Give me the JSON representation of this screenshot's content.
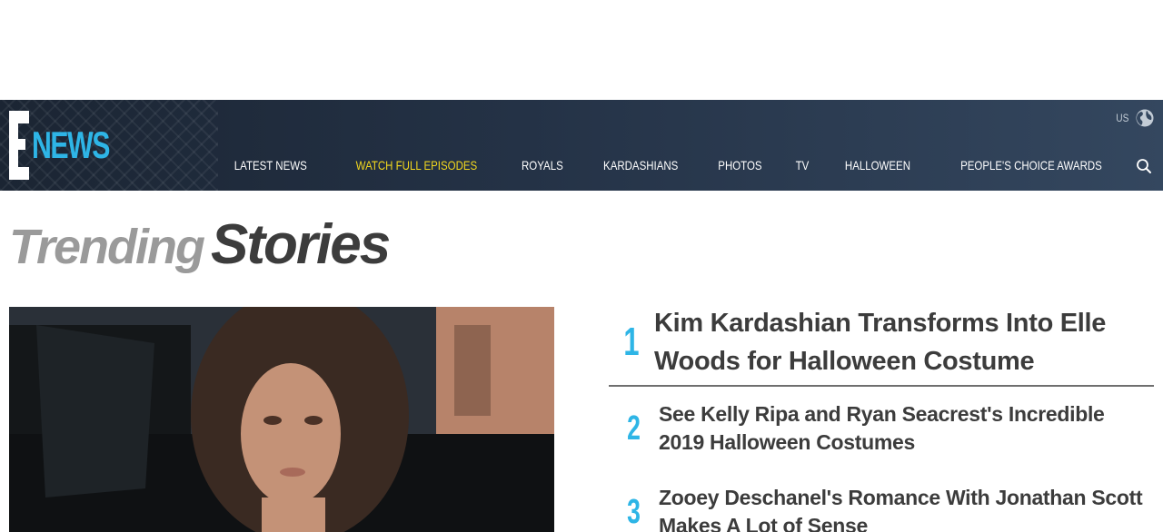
{
  "header": {
    "logo": {
      "letter": "E",
      "word": "NEWS"
    },
    "nav": [
      {
        "label": "Latest News",
        "active": false
      },
      {
        "label": "Watch Full Episodes",
        "active": true
      },
      {
        "label": "Royals",
        "active": false
      },
      {
        "label": "Kardashians",
        "active": false
      },
      {
        "label": "Photos",
        "active": false
      },
      {
        "label": "TV",
        "active": false
      },
      {
        "label": "Halloween",
        "active": false
      },
      {
        "label": "People's Choice Awards",
        "active": false
      }
    ],
    "region": {
      "label": "US",
      "icon": "globe-icon"
    },
    "search_icon": "search-icon"
  },
  "trending": {
    "title_light": "Trending",
    "title_dark": "Stories",
    "stories": [
      {
        "rank": "1",
        "title": "Kim Kardashian Transforms Into Elle Woods for Halloween Costume"
      },
      {
        "rank": "2",
        "title": "See Kelly Ripa and Ryan Seacrest's Incredible 2019 Halloween Costumes"
      },
      {
        "rank": "3",
        "title": "Zooey Deschanel's Romance With Jonathan Scott Makes A Lot of Sense"
      }
    ]
  },
  "colors": {
    "accent": "#2eb5e6",
    "nav_active": "#f3d81e",
    "header_bg": "#243246",
    "title_dark": "#3c3c3c",
    "title_light": "#9a9a9a"
  }
}
